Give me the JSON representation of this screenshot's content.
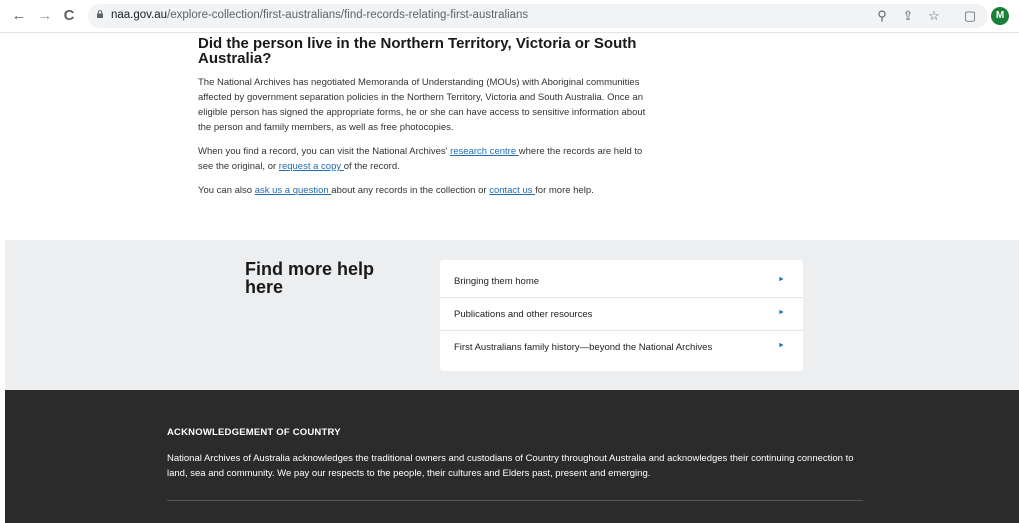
{
  "browser": {
    "url_domain": "naa.gov.au",
    "url_path": "/explore-collection/first-australians/find-records-relating-first-australians",
    "avatar_letter": "M",
    "icons": {
      "back": "←",
      "forward": "→",
      "reload": "C",
      "zoom": "⚲",
      "share": "⇪",
      "bookmark": "☆",
      "sidebar": "▢"
    }
  },
  "section": {
    "heading": "Did the person live in the Northern Territory, Victoria or South Australia?",
    "para1": "The National Archives has negotiated Memoranda of Understanding (MOUs) with Aboriginal communities affected by government separation policies in the Northern Territory, Victoria and South Australia. Once an eligible person has signed the appropriate forms, he or she can have access to sensitive information about the person and family members, as well as free photocopies.",
    "para2_a": "When you find a record, you can visit the National Archives' ",
    "para2_link1": "research centre ",
    "para2_b": "where the records are held to see the original, or ",
    "para2_link2": "request a copy ",
    "para2_c": "of the record.",
    "para3_a": "You can also ",
    "para3_link1": "ask us a question ",
    "para3_b": "about any records in the collection or ",
    "para3_link2": "contact us ",
    "para3_c": "for more help."
  },
  "help": {
    "title": "Find more help here",
    "links": [
      {
        "label": "Bringing them home",
        "arrow": "►"
      },
      {
        "label": "Publications and other resources",
        "arrow": "►"
      },
      {
        "label": "First Australians family history—beyond the National Archives",
        "arrow": "►"
      }
    ]
  },
  "footer": {
    "ack_title": "ACKNOWLEDGEMENT OF COUNTRY",
    "ack_body": "National Archives of Australia acknowledges the traditional owners and custodians of Country throughout Australia and acknowledges their continuing connection to land, sea and community. We pay our respects to the people, their cultures and Elders past, present and emerging."
  },
  "colors": {
    "link": "#1f6cb0",
    "help_bg": "#eceef0",
    "footer_bg": "#2b2b2b",
    "avatar": "#188038"
  }
}
